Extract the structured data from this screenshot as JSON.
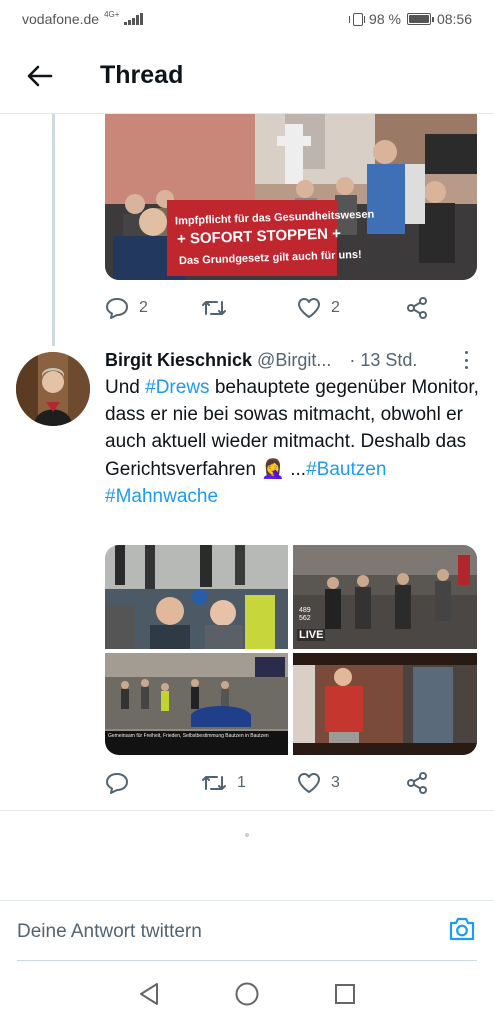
{
  "status_bar": {
    "carrier": "vodafone.de",
    "network": "4G+",
    "battery": "98 %",
    "battery_level": 0.98,
    "time": "08:56"
  },
  "header": {
    "title": "Thread",
    "back_icon": "arrow-left-icon"
  },
  "prev_tweet": {
    "banner_line1": "Impfpflicht für das Gesundheitswesen",
    "banner_line2": "+ SOFORT STOPPEN +",
    "banner_line3": "Das Grundgesetz gilt auch für uns!",
    "actions": {
      "reply_count": "2",
      "retweet_count": "",
      "like_count": "2"
    }
  },
  "tweet": {
    "author_name": "Birgit Kieschnick",
    "handle": "@Birgit...",
    "time_sep": "·",
    "time": "13 Std.",
    "text_part1": "Und ",
    "hashtag_drews": "#Drews",
    "text_part2": " behauptete gegenüber Monitor, dass er nie bei sowas mitmacht, obwohl er auch aktuell wieder mitmacht. Deshalb das Gerichtsverfahren",
    "emoji": "🤦‍♀️",
    "text_part3": " ...",
    "hashtag_bautzen": "#Bautzen",
    "hashtag_mahnwache": "#Mahnwache",
    "media": {
      "live_label": "LIVE",
      "viewers_a": "489",
      "viewers_b": "562",
      "video_caption": "Gemeinsam für Freiheit, Frieden, Selbstbestimmung Bautzen in Bautzen"
    },
    "actions": {
      "reply_count": "",
      "retweet_count": "1",
      "like_count": "3"
    }
  },
  "composer": {
    "placeholder": "Deine Antwort twittern",
    "camera_icon": "camera-icon"
  },
  "navbar": {
    "back": "nav-back-icon",
    "home": "nav-home-icon",
    "recents": "nav-recents-icon"
  },
  "colors": {
    "accent": "#1d9bf0",
    "text": "#0f1419",
    "secondary": "#536471",
    "divider": "#e6ecf0"
  }
}
